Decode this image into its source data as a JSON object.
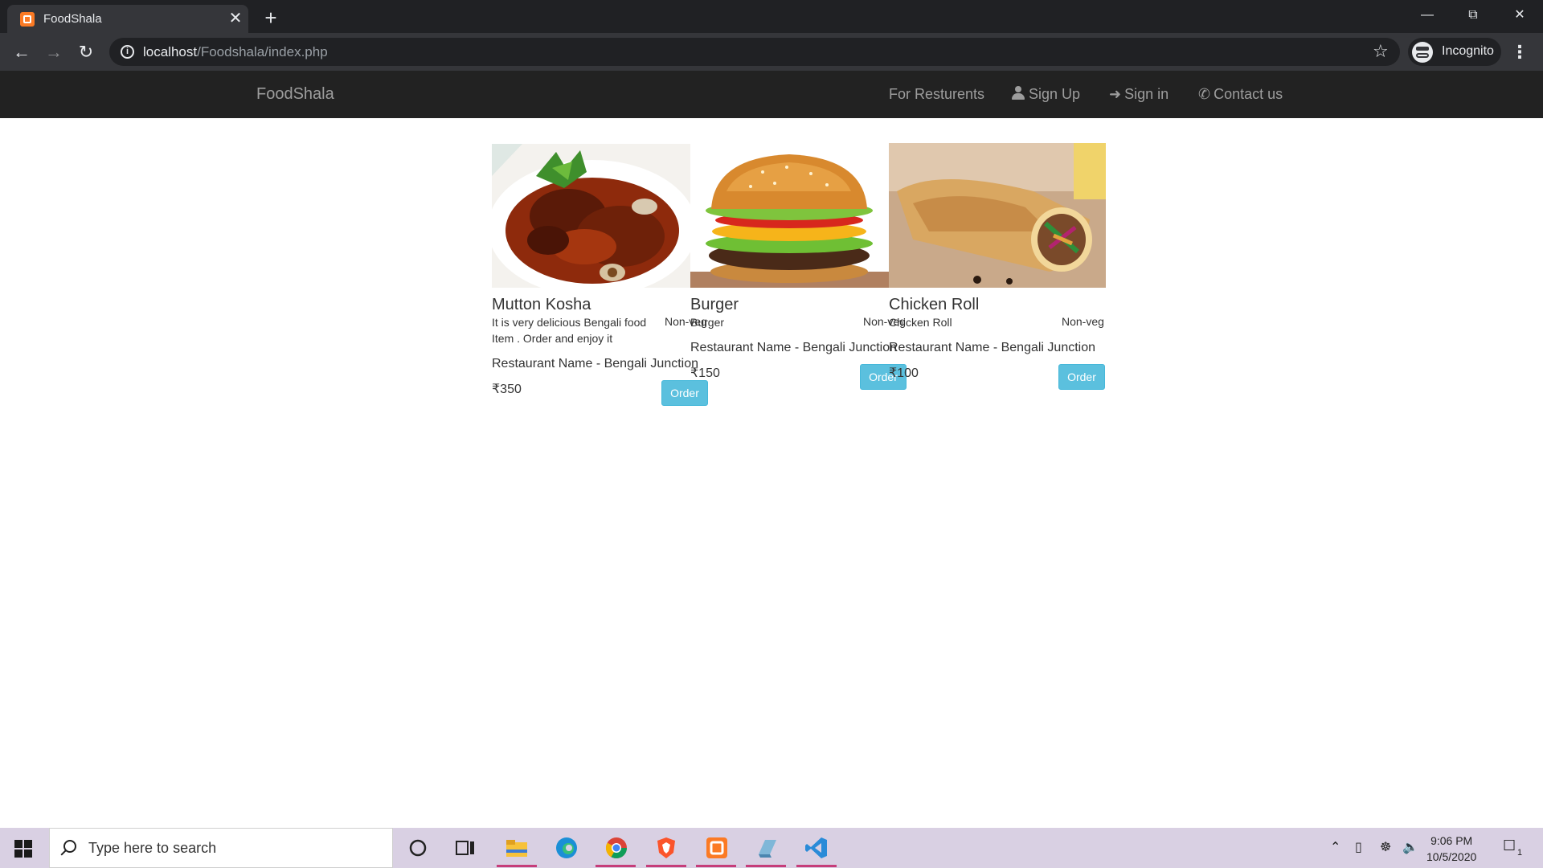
{
  "browser": {
    "tab_title": "FoodShala",
    "url_host": "localhost",
    "url_path": "/Foodshala/index.php",
    "profile_label": "Incognito"
  },
  "site": {
    "brand": "FoodShala",
    "nav": {
      "restaurants": "For Resturents",
      "signup": "Sign Up",
      "signin": "Sign in",
      "contact": "Contact us"
    }
  },
  "foods": [
    {
      "name": "Mutton Kosha",
      "description": "It is very delicious Bengali food Item . Order and enjoy it",
      "type": "Non-veg",
      "restaurant": "Restaurant Name - Bengali Junction",
      "price": "₹350",
      "order_label": "Order"
    },
    {
      "name": "Burger",
      "description": "Burger",
      "type": "Non-veg",
      "restaurant": "Restaurant Name - Bengali Junction",
      "price": "₹150",
      "order_label": "Order"
    },
    {
      "name": "Chicken Roll",
      "description": "Chicken Roll",
      "type": "Non-veg",
      "restaurant": "Restaurant Name - Bengali Junction",
      "price": "₹100",
      "order_label": "Order"
    }
  ],
  "taskbar": {
    "search_placeholder": "Type here to search",
    "time": "9:06 PM",
    "date": "10/5/2020",
    "notification_count": "1"
  },
  "colors": {
    "navbar": "#222222",
    "order_button": "#5bc0de",
    "chrome_dark": "#202124"
  }
}
